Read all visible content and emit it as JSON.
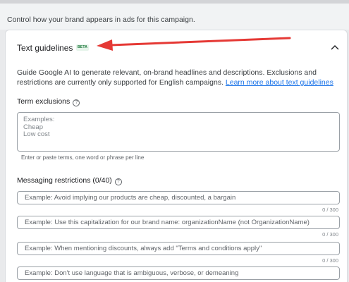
{
  "intro_text": "Control how your brand appears in ads for this campaign.",
  "card": {
    "title": "Text guidelines",
    "badge": "BETA",
    "collapse_icon": "chevron-up-icon",
    "description": "Guide Google AI to generate relevant, on-brand headlines and descriptions. Exclusions and restrictions are currently only supported for English campaigns.",
    "learn_more_link": "Learn more about text guidelines"
  },
  "term_exclusions": {
    "label": "Term exclusions",
    "help_icon": "help-circle-icon",
    "placeholder": "Examples:\nCheap\nLow cost",
    "hint": "Enter or paste terms, one word or phrase per line"
  },
  "messaging_restrictions": {
    "label": "Messaging restrictions (0/40)",
    "help_icon": "help-circle-icon",
    "fields": [
      {
        "placeholder": "Example: Avoid implying our products are cheap, discounted, a bargain",
        "counter": "0 / 300"
      },
      {
        "placeholder": "Example: Use this capitalization for our brand name: organizationName (not OrganizationName)",
        "counter": "0 / 300"
      },
      {
        "placeholder": "Example: When mentioning discounts, always add \"Terms and conditions apply\"",
        "counter": "0 / 300"
      },
      {
        "placeholder": "Example: Don't use language that is ambiguous, verbose, or demeaning",
        "counter": ""
      }
    ]
  },
  "colors": {
    "link": "#1a73e8",
    "badge_bg": "#e6f4ea",
    "badge_text": "#137333",
    "annotation_arrow": "#e53935"
  }
}
